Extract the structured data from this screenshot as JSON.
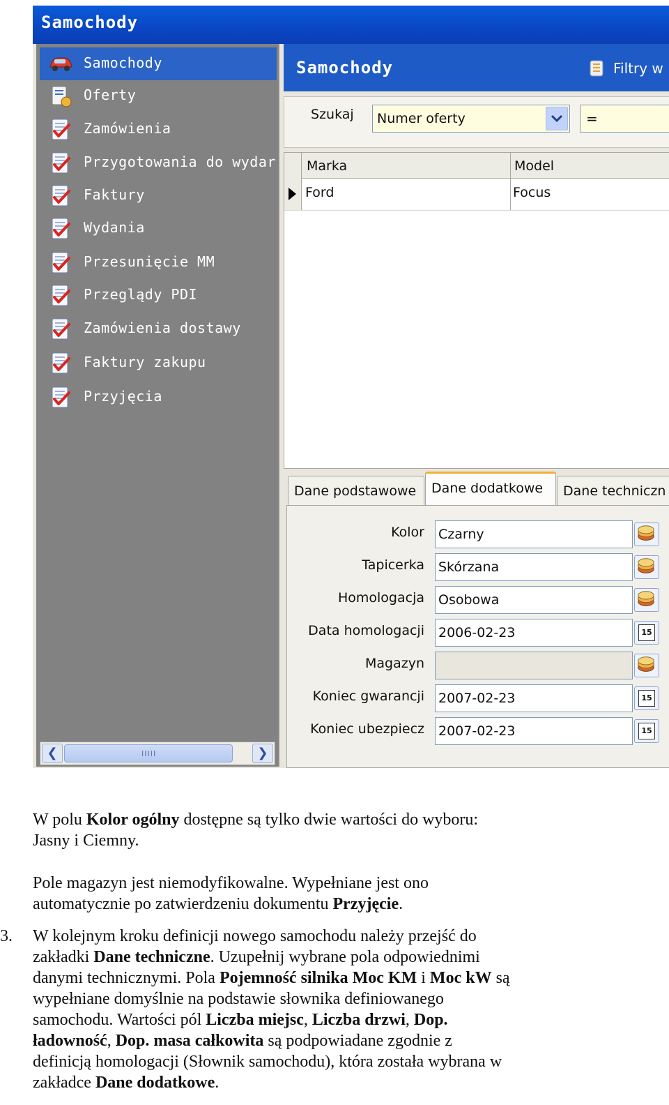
{
  "window": {
    "title": "Samochody"
  },
  "sidebar": {
    "items": [
      {
        "label": "Samochody",
        "icon": "car-icon",
        "selected": true
      },
      {
        "label": "Oferty",
        "icon": "offer-icon",
        "selected": false
      },
      {
        "label": "Zamówienia",
        "icon": "checklist-icon",
        "selected": false
      },
      {
        "label": "Przygotowania do wydar",
        "icon": "checklist-icon",
        "selected": false
      },
      {
        "label": "Faktury",
        "icon": "checklist-icon",
        "selected": false
      },
      {
        "label": "Wydania",
        "icon": "checklist-icon",
        "selected": false
      },
      {
        "label": "Przesunięcie MM",
        "icon": "checklist-icon",
        "selected": false
      },
      {
        "label": "Przeglądy PDI",
        "icon": "checklist-icon",
        "selected": false
      },
      {
        "label": "Zamówienia dostawy",
        "icon": "checklist-icon",
        "selected": false
      },
      {
        "label": "Faktury zakupu",
        "icon": "checklist-icon",
        "selected": false
      },
      {
        "label": "Przyjęcia",
        "icon": "checklist-icon",
        "selected": false
      }
    ],
    "scroll_grip": "IIIII"
  },
  "main": {
    "title": "Samochody",
    "filter_label": "Filtry w"
  },
  "search": {
    "label": "Szukaj",
    "field_value": "Numer oferty",
    "operator_value": "="
  },
  "grid": {
    "columns": [
      "Marka",
      "Model"
    ],
    "rows": [
      [
        "Ford",
        "Focus"
      ]
    ]
  },
  "tabs": [
    {
      "label": "Dane podstawowe",
      "active": false
    },
    {
      "label": "Dane dodatkowe",
      "active": true
    },
    {
      "label": "Dane techniczn",
      "active": false
    }
  ],
  "fields": [
    {
      "label": "Kolor",
      "value": "Czarny",
      "button": "dictionary",
      "readonly": false
    },
    {
      "label": "Tapicerka",
      "value": "Skórzana",
      "button": "dictionary",
      "readonly": false
    },
    {
      "label": "Homologacja",
      "value": "Osobowa",
      "button": "dictionary",
      "readonly": false
    },
    {
      "label": "Data homologacji",
      "value": "2006-02-23",
      "button": "calendar",
      "readonly": false
    },
    {
      "label": "Magazyn",
      "value": "",
      "button": "dictionary",
      "readonly": true
    },
    {
      "label": "Koniec gwarancji",
      "value": "2007-02-23",
      "button": "calendar",
      "readonly": false
    },
    {
      "label": "Koniec ubezpiecz",
      "value": "2007-02-23",
      "button": "calendar",
      "readonly": false
    }
  ],
  "calendar_glyph": "15",
  "colors": {
    "title_bar": "#0a46c4",
    "selected_item": "#2b63c6",
    "sidebar_bg": "#838282",
    "tab_accent": "#f4b03a"
  },
  "doc": {
    "p1": [
      {
        "t": "W polu "
      },
      {
        "t": "Kolor ogólny",
        "b": true
      },
      {
        "t": " dostępne są tylko dwie wartości do wyboru:"
      },
      {
        "br": true
      },
      {
        "t": "Jasny i Ciemny."
      }
    ],
    "p2": [
      {
        "t": "Pole magazyn jest niemodyfikowalne. Wypełniane jest ono"
      },
      {
        "br": true
      },
      {
        "t": "automatycznie po zatwierdzeniu dokumentu "
      },
      {
        "t": "Przyjęcie",
        "b": true
      },
      {
        "t": "."
      }
    ],
    "p3_number": "3.",
    "p3": [
      {
        "t": "W kolejnym kroku definicji nowego samochodu należy przejść do"
      },
      {
        "br": true
      },
      {
        "t": "zakładki "
      },
      {
        "t": "Dane techniczne",
        "b": true
      },
      {
        "t": ". Uzupełnij wybrane pola odpowiednimi"
      },
      {
        "br": true
      },
      {
        "t": "danymi technicznymi. Pola "
      },
      {
        "t": "Pojemność silnika Moc KM",
        "b": true
      },
      {
        "t": " i "
      },
      {
        "t": "Moc kW",
        "b": true
      },
      {
        "t": " są"
      },
      {
        "br": true
      },
      {
        "t": "wypełniane domyślnie na podstawie słownika definiowanego"
      },
      {
        "br": true
      },
      {
        "t": "samochodu.  Wartości pól "
      },
      {
        "t": "Liczba miejsc",
        "b": true
      },
      {
        "t": ", "
      },
      {
        "t": "Liczba drzwi",
        "b": true
      },
      {
        "t": ", "
      },
      {
        "t": "Dop.",
        "b": true
      },
      {
        "br": true
      },
      {
        "t": "ładowność",
        "b": true
      },
      {
        "t": ", "
      },
      {
        "t": "Dop. masa całkowita",
        "b": true
      },
      {
        "t": " są podpowiadane  zgodnie z"
      },
      {
        "br": true
      },
      {
        "t": "definicją homologacji (Słownik samochodu), która została wybrana w"
      },
      {
        "br": true
      },
      {
        "t": "zakładce "
      },
      {
        "t": "Dane dodatkowe",
        "b": true
      },
      {
        "t": "."
      }
    ]
  }
}
